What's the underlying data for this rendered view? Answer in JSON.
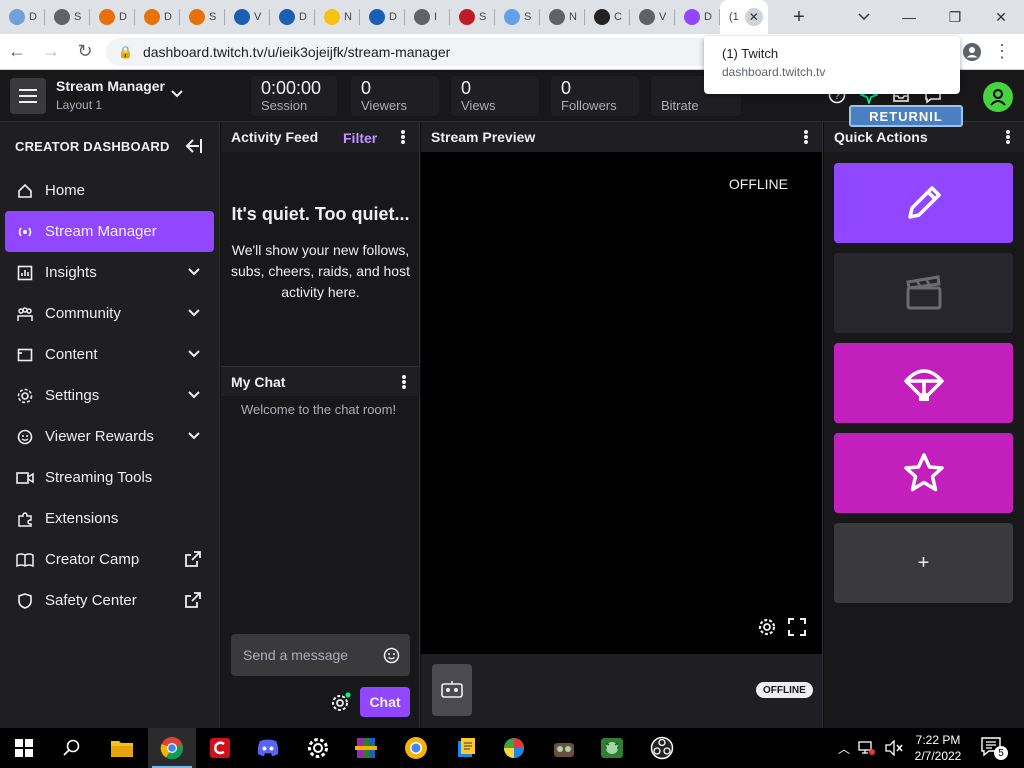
{
  "browser": {
    "tabs": [
      {
        "label": "D",
        "color": "#6fa0d8"
      },
      {
        "label": "S",
        "color": "#5f6368"
      },
      {
        "label": "D",
        "color": "#e8710a"
      },
      {
        "label": "D",
        "color": "#e8710a"
      },
      {
        "label": "S",
        "color": "#e8710a"
      },
      {
        "label": "V",
        "color": "#1a5fb4"
      },
      {
        "label": "D",
        "color": "#1a5fb4"
      },
      {
        "label": "N",
        "color": "#f5c211"
      },
      {
        "label": "D",
        "color": "#1a5fb4"
      },
      {
        "label": "I",
        "color": "#5f6368"
      },
      {
        "label": "S",
        "color": "#c01c28"
      },
      {
        "label": "S",
        "color": "#62a0ea"
      },
      {
        "label": "N",
        "color": "#5f6368"
      },
      {
        "label": "C",
        "color": "#222222"
      },
      {
        "label": "V",
        "color": "#5f6368"
      },
      {
        "label": "D",
        "color": "#9147ff"
      }
    ],
    "active_tab_label": "(1",
    "url": "dashboard.twitch.tv/u/ieik3ojeijfk/stream-manager",
    "notification": {
      "title": "(1) Twitch",
      "subtitle": "dashboard.twitch.tv"
    }
  },
  "header": {
    "title": "Stream Manager",
    "layout": "Layout 1",
    "stats": [
      {
        "value": "0:00:00",
        "label": "Session"
      },
      {
        "value": "0",
        "label": "Viewers"
      },
      {
        "value": "0",
        "label": "Views"
      },
      {
        "value": "0",
        "label": "Followers"
      },
      {
        "value": "",
        "label": "Bitrate"
      }
    ],
    "overlay_badge": "RETURNIL"
  },
  "sidebar": {
    "heading": "CREATOR DASHBOARD",
    "items": [
      {
        "label": "Home",
        "icon": "home-icon"
      },
      {
        "label": "Stream Manager",
        "icon": "broadcast-icon"
      },
      {
        "label": "Insights",
        "icon": "insights-icon"
      },
      {
        "label": "Community",
        "icon": "community-icon"
      },
      {
        "label": "Content",
        "icon": "content-icon"
      },
      {
        "label": "Settings",
        "icon": "gear-icon"
      },
      {
        "label": "Viewer Rewards",
        "icon": "rewards-icon"
      },
      {
        "label": "Streaming Tools",
        "icon": "camera-icon"
      },
      {
        "label": "Extensions",
        "icon": "puzzle-icon"
      },
      {
        "label": "Creator Camp",
        "icon": "book-icon"
      },
      {
        "label": "Safety Center",
        "icon": "shield-icon"
      }
    ]
  },
  "activity": {
    "title": "Activity Feed",
    "filter": "Filter",
    "empty_title": "It's quiet. Too quiet...",
    "empty_body": "We'll show your new follows, subs, cheers, raids, and host activity here."
  },
  "chat": {
    "title": "My Chat",
    "welcome": "Welcome to the chat room!",
    "placeholder": "Send a message",
    "send_label": "Chat"
  },
  "preview": {
    "title": "Stream Preview",
    "status": "OFFLINE",
    "pill": "OFFLINE"
  },
  "quick_actions": {
    "title": "Quick Actions",
    "tiles": [
      {
        "icon": "pencil-icon",
        "color": "#9147ff"
      },
      {
        "icon": "clapper-icon",
        "color": "#26262c"
      },
      {
        "icon": "parachute-icon",
        "color": "#c21fbd"
      },
      {
        "icon": "star-icon",
        "color": "#c21fbd"
      },
      {
        "icon": "plus-icon",
        "label": "+",
        "color": "#3a3a3d"
      }
    ]
  },
  "taskbar": {
    "time": "7:22 PM",
    "date": "2/7/2022",
    "notification_count": "5"
  }
}
